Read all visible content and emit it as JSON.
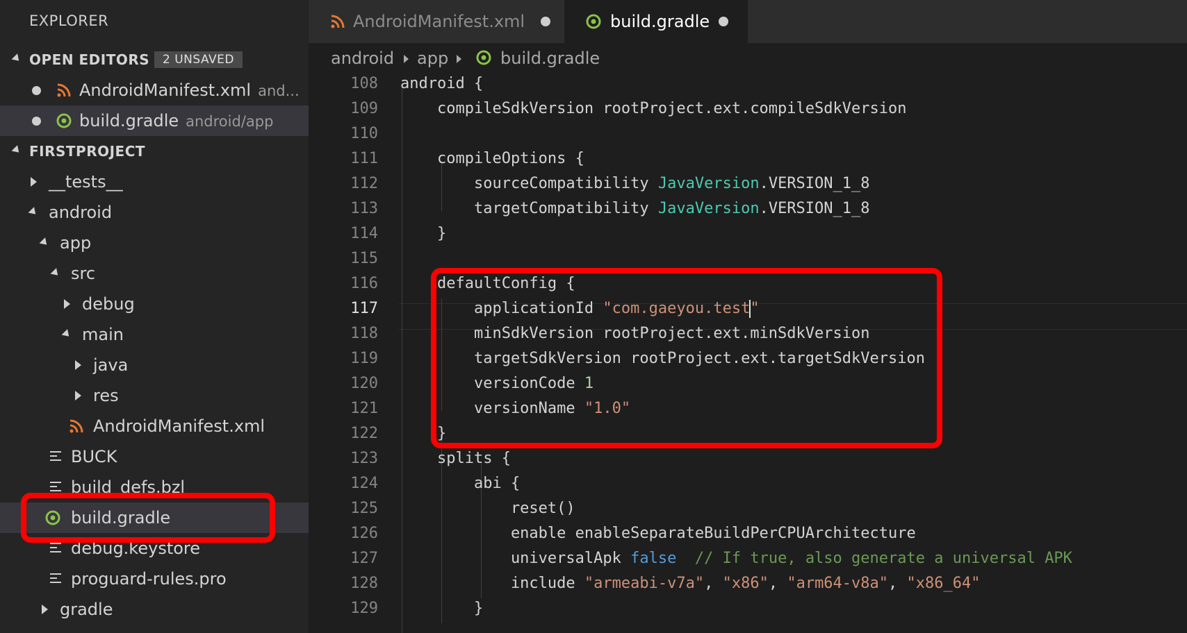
{
  "sidebar": {
    "title": "EXPLORER",
    "open_editors": {
      "header": "OPEN EDITORS",
      "badge": "2 UNSAVED",
      "items": [
        {
          "name": "AndroidManifest.xml",
          "hint": "and..."
        },
        {
          "name": "build.gradle",
          "hint": "android/app"
        }
      ]
    },
    "project": {
      "header": "FIRSTPROJECT",
      "items": [
        {
          "label": "__tests__"
        },
        {
          "label": "android"
        },
        {
          "label": "app"
        },
        {
          "label": "src"
        },
        {
          "label": "debug"
        },
        {
          "label": "main"
        },
        {
          "label": "java"
        },
        {
          "label": "res"
        },
        {
          "label": "AndroidManifest.xml"
        },
        {
          "label": "BUCK"
        },
        {
          "label": "build_defs.bzl"
        },
        {
          "label": "build.gradle"
        },
        {
          "label": "debug.keystore"
        },
        {
          "label": "proguard-rules.pro"
        },
        {
          "label": "gradle"
        }
      ]
    }
  },
  "tabs": [
    {
      "label": "AndroidManifest.xml",
      "icon": "rss-icon",
      "unsaved": true
    },
    {
      "label": "build.gradle",
      "icon": "gradle-icon",
      "unsaved": true
    }
  ],
  "breadcrumb": [
    "android",
    "app",
    "build.gradle"
  ],
  "editor": {
    "line_numbers": [
      "108",
      "109",
      "110",
      "111",
      "112",
      "113",
      "114",
      "115",
      "116",
      "117",
      "118",
      "119",
      "120",
      "121",
      "122",
      "123",
      "124",
      "125",
      "126",
      "127",
      "128",
      "129"
    ],
    "lines": [
      "android {",
      "    compileSdkVersion rootProject.ext.compileSdkVersion",
      "",
      "    compileOptions {",
      "        sourceCompatibility JavaVersion.VERSION_1_8",
      "        targetCompatibility JavaVersion.VERSION_1_8",
      "    }",
      "",
      "    defaultConfig {",
      "        applicationId \"com.gaeyou.test\"",
      "        minSdkVersion rootProject.ext.minSdkVersion",
      "        targetSdkVersion rootProject.ext.targetSdkVersion",
      "        versionCode 1",
      "        versionName \"1.0\"",
      "    }",
      "    splits {",
      "        abi {",
      "            reset()",
      "            enable enableSeparateBuildPerCPUArchitecture",
      "            universalApk false  // If true, also generate a universal APK",
      "            include \"armeabi-v7a\", \"x86\", \"arm64-v8a\", \"x86_64\"",
      "        }"
    ],
    "active_line": "117"
  },
  "colors": {
    "annotation": "#ff0000",
    "gradle_icon": "#8bc34a",
    "rss_icon": "#e37933",
    "string": "#ce9178",
    "type": "#4ec9b0",
    "keyword": "#569cd6",
    "comment": "#6a9955",
    "number": "#b5cea8"
  }
}
